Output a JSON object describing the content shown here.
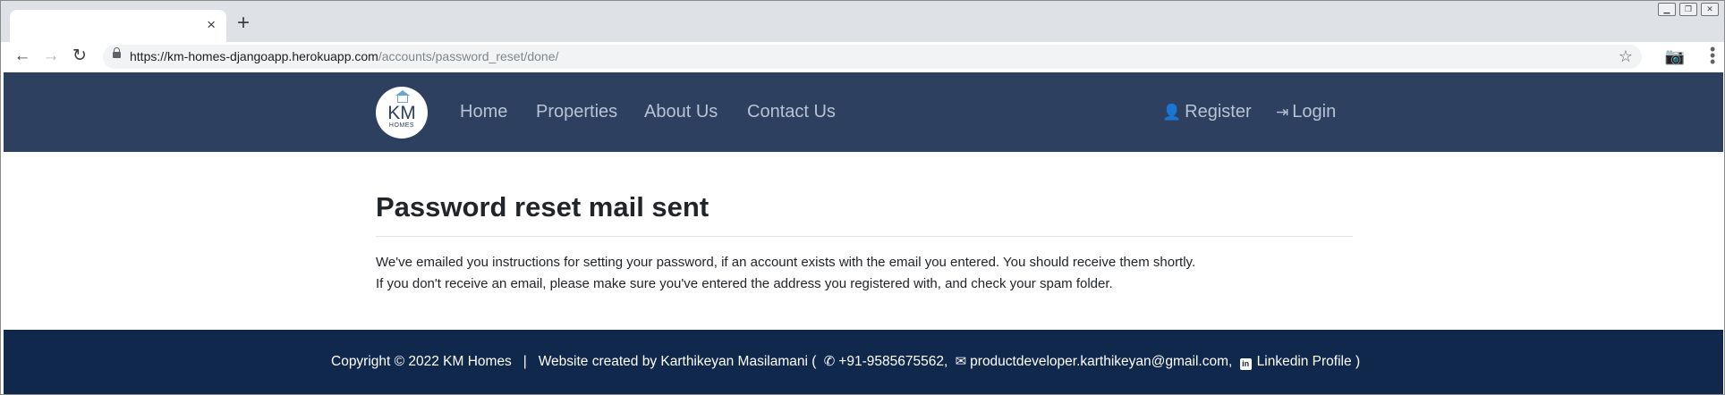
{
  "browser": {
    "tab_close": "×",
    "new_tab": "+",
    "url_host": "https://km-homes-djangoapp.herokuapp.com",
    "url_path": "/accounts/password_reset/done/"
  },
  "nav": {
    "logo_text": "KM",
    "logo_subtext": "HOMES",
    "links": [
      "Home",
      "Properties",
      "About Us",
      "Contact Us"
    ],
    "register": "Register",
    "login": "Login"
  },
  "content": {
    "title": "Password reset mail sent",
    "line1": "We've emailed you instructions for setting your password, if an account exists with the email you entered. You should receive them shortly.",
    "line2": "If you don't receive an email, please make sure you've entered the address you registered with, and check your spam folder."
  },
  "footer": {
    "copyright": "Copyright © 2022 KM Homes",
    "separator": "|",
    "created_by": "Website created by Karthikeyan Masilamani (",
    "phone": "+91-9585675562,",
    "email": "productdeveloper.karthikeyan@gmail.com,",
    "linkedin": "Linkedin Profile",
    "close_paren": ")"
  },
  "colors": {
    "navbar": "#2d4060",
    "footer": "#10284c",
    "nav_link": "#b7c3d4"
  }
}
